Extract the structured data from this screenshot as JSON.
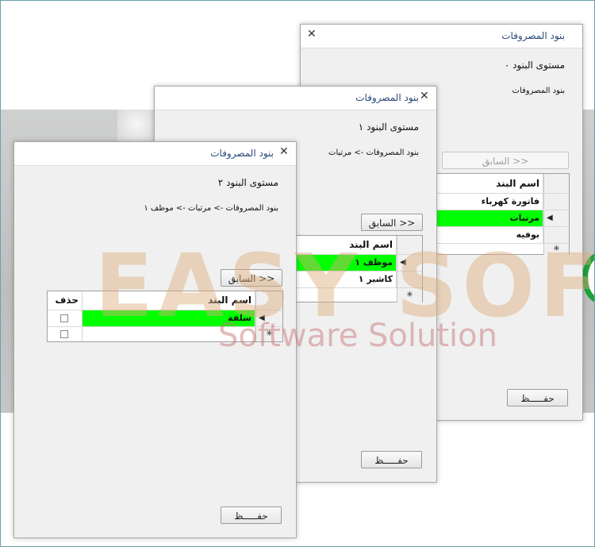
{
  "watermark": {
    "brand": "EASY SOFT",
    "tagline": "Software Solution"
  },
  "windows": [
    {
      "title": "بنود المصروفات",
      "level": "مستوى البنود ٠",
      "path": "بنود المصروفات",
      "back_label": "<< السابق",
      "back_enabled": false,
      "save_label": "حفـــــظ",
      "grid": {
        "columns": [
          "اسم البند"
        ],
        "rows": [
          {
            "name": "فاتورة كهرباء",
            "selected": false,
            "current": false
          },
          {
            "name": "مرتبات",
            "selected": true,
            "current": true
          },
          {
            "name": "بوفيه",
            "selected": false,
            "current": false
          }
        ]
      }
    },
    {
      "title": "بنود المصروفات",
      "level": "مستوى البنود ١",
      "path": "بنود المصروفات -> مرتبات",
      "back_label": "<< السابق",
      "back_enabled": true,
      "save_label": "حفـــــظ",
      "grid": {
        "columns": [
          "اسم البند"
        ],
        "rows": [
          {
            "name": "موظف ١",
            "selected": true,
            "current": true
          },
          {
            "name": "كاشير ١",
            "selected": false,
            "current": false
          }
        ]
      }
    },
    {
      "title": "بنود المصروفات",
      "level": "مستوى البنود ٢",
      "path": "بنود المصروفات -> مرتبات -> موظف ١",
      "back_label": "<< السابق",
      "back_enabled": true,
      "save_label": "حفـــــظ",
      "grid": {
        "columns": [
          "اسم البند",
          "حذف"
        ],
        "rows": [
          {
            "name": "سلفة",
            "selected": true,
            "current": true,
            "delete": false
          }
        ]
      }
    }
  ],
  "colors": {
    "selected_row": "#00ff00",
    "title_text": "#2b4a7a"
  }
}
